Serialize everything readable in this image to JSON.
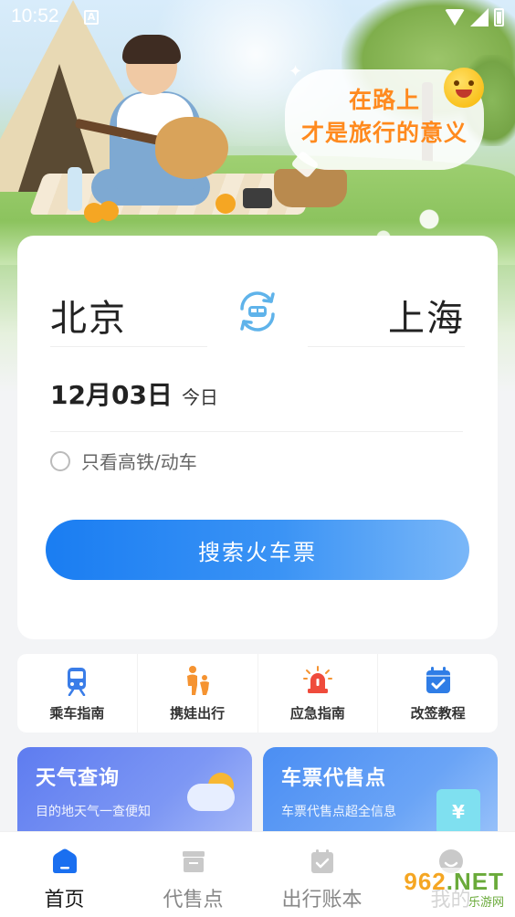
{
  "status_bar": {
    "time": "10:52",
    "indicator": "A"
  },
  "hero": {
    "bubble_line1": "在路上",
    "bubble_line2": "才是旅行的意义"
  },
  "search": {
    "from_city": "北京",
    "to_city": "上海",
    "date": "12月03日",
    "date_hint": "今日",
    "option_label": "只看高铁/动车",
    "option_checked": false,
    "search_button_label": "搜索火车票",
    "accent_color": "#1a7df2"
  },
  "quick_entries": [
    {
      "label": "乘车指南",
      "icon": "train-icon",
      "color": "#3a7de8"
    },
    {
      "label": "携娃出行",
      "icon": "parent-child-icon",
      "color": "#f59331"
    },
    {
      "label": "应急指南",
      "icon": "alarm-light-icon",
      "color": "#ef4b3c"
    },
    {
      "label": "改签教程",
      "icon": "calendar-check-icon",
      "color": "#2f7de6"
    }
  ],
  "features": {
    "weather": {
      "title": "天气查询",
      "desc": "目的地天气一查便知"
    },
    "agent": {
      "title": "车票代售点",
      "desc": "车票代售点超全信息"
    }
  },
  "tabs": [
    {
      "label": "首页",
      "icon": "home-icon",
      "active": true
    },
    {
      "label": "代售点",
      "icon": "store-icon",
      "active": false
    },
    {
      "label": "出行账本",
      "icon": "ledger-icon",
      "active": false
    },
    {
      "label": "我的",
      "icon": "profile-icon",
      "active": false
    }
  ],
  "watermark": {
    "main": "962",
    "main_suffix": ".NET",
    "sub": "乐游网"
  }
}
